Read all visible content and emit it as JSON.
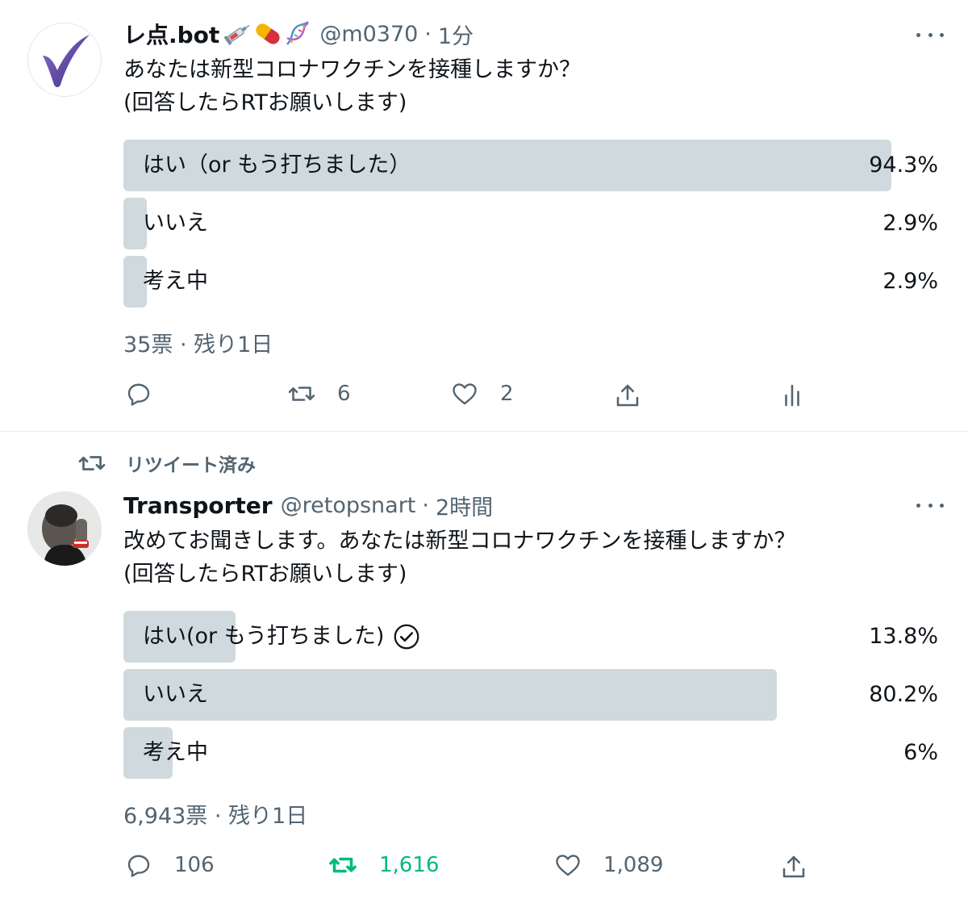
{
  "tweets": [
    {
      "author": {
        "name": "レ点.bot",
        "handle": "@m0370",
        "time": "1分",
        "emoji": [
          "syringe-icon",
          "pill-icon",
          "dna-icon"
        ]
      },
      "text_lines": [
        "あなたは新型コロナワクチンを接種しますか？",
        "(回答したらRTお願いします)"
      ],
      "poll": {
        "options": [
          {
            "label": "はい（or もう打ちました）",
            "percent": "94.3%",
            "fraction": 0.943,
            "voted": false
          },
          {
            "label": "いいえ",
            "percent": "2.9%",
            "fraction": 0.029,
            "voted": false
          },
          {
            "label": "考え中",
            "percent": "2.9%",
            "fraction": 0.029,
            "voted": false
          }
        ],
        "footer": "35票 · 残り1日"
      },
      "actions": {
        "reply": "",
        "retweet": "6",
        "like": "2",
        "share": "",
        "analytics": ""
      }
    },
    {
      "retweeted_label": "リツイート済み",
      "author": {
        "name": "Transporter",
        "handle": "@retopsnart",
        "time": "2時間"
      },
      "text_lines": [
        "改めてお聞きします。あなたは新型コロナワクチンを接種しますか？",
        "(回答したらRTお願いします)"
      ],
      "poll": {
        "options": [
          {
            "label": "はい(or もう打ちました)",
            "percent": "13.8%",
            "fraction": 0.138,
            "voted": true
          },
          {
            "label": "いいえ",
            "percent": "80.2%",
            "fraction": 0.802,
            "voted": false
          },
          {
            "label": "考え中",
            "percent": "6%",
            "fraction": 0.06,
            "voted": false
          }
        ],
        "footer": "6,943票 · 残り1日"
      },
      "actions": {
        "reply": "106",
        "retweet": "1,616",
        "like": "1,089",
        "share": ""
      }
    }
  ],
  "colors": {
    "text": "#0f1419",
    "secondary": "#536471",
    "poll_bar": "#cfd9de",
    "retweet_active": "#00ba7c",
    "check_purple": "#5b3d9c"
  }
}
